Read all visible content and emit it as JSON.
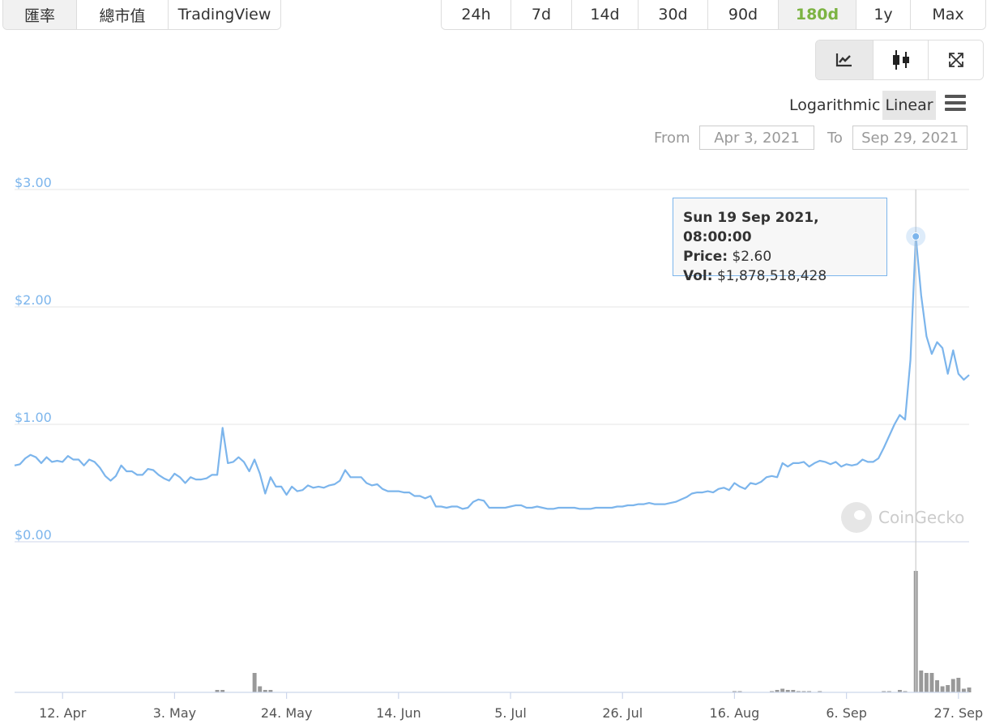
{
  "top_tabs": [
    {
      "label": "匯率",
      "active": true
    },
    {
      "label": "總市值",
      "active": false
    },
    {
      "label": "TradingView",
      "active": false
    }
  ],
  "range_tabs": [
    {
      "label": "24h",
      "active": false
    },
    {
      "label": "7d",
      "active": false
    },
    {
      "label": "14d",
      "active": false
    },
    {
      "label": "30d",
      "active": false
    },
    {
      "label": "90d",
      "active": false
    },
    {
      "label": "180d",
      "active": true
    },
    {
      "label": "1y",
      "active": false
    },
    {
      "label": "Max",
      "active": false
    }
  ],
  "tools": [
    {
      "name": "line-chart-icon",
      "active": true
    },
    {
      "name": "candlestick-icon",
      "active": false
    },
    {
      "name": "fullscreen-icon",
      "active": false
    }
  ],
  "scale": {
    "logarithmic": "Logarithmic",
    "linear": "Linear",
    "selected": "Linear"
  },
  "date_range": {
    "from_label": "From",
    "from_value": "Apr 3, 2021",
    "to_label": "To",
    "to_value": "Sep 29, 2021"
  },
  "tooltip": {
    "date": "Sun 19 Sep 2021, 08:00:00",
    "price_label": "Price:",
    "price_value": "$2.60",
    "vol_label": "Vol:",
    "vol_value": "$1,878,518,428"
  },
  "watermark": "CoinGecko",
  "colors": {
    "line": "#7cb5ec",
    "axis_label": "#7cb5ec",
    "volume": "#999999",
    "active_range": "#7cb342",
    "grid": "#e6e6e6"
  },
  "chart_data": {
    "type": "line",
    "x_start": "2021-04-03",
    "x_end": "2021-09-29",
    "ylim": [
      0,
      3
    ],
    "y_ticks": [
      {
        "value": 0,
        "label": "$0.00"
      },
      {
        "value": 1,
        "label": "$1.00"
      },
      {
        "value": 2,
        "label": "$2.00"
      },
      {
        "value": 3,
        "label": "$3.00"
      }
    ],
    "x_ticks": [
      {
        "date": "2021-04-12",
        "label": "12. Apr"
      },
      {
        "date": "2021-05-03",
        "label": "3. May"
      },
      {
        "date": "2021-05-24",
        "label": "24. May"
      },
      {
        "date": "2021-06-14",
        "label": "14. Jun"
      },
      {
        "date": "2021-07-05",
        "label": "5. Jul"
      },
      {
        "date": "2021-07-26",
        "label": "26. Jul"
      },
      {
        "date": "2021-08-16",
        "label": "16. Aug"
      },
      {
        "date": "2021-09-06",
        "label": "6. Sep"
      },
      {
        "date": "2021-09-27",
        "label": "27. Sep"
      }
    ],
    "grid": true,
    "hover": {
      "date": "2021-09-19",
      "price": 2.6
    },
    "price_series": {
      "name": "Price",
      "points": [
        [
          "2021-04-03",
          0.65
        ],
        [
          "2021-04-04",
          0.66
        ],
        [
          "2021-04-05",
          0.71
        ],
        [
          "2021-04-06",
          0.74
        ],
        [
          "2021-04-07",
          0.72
        ],
        [
          "2021-04-08",
          0.67
        ],
        [
          "2021-04-09",
          0.72
        ],
        [
          "2021-04-10",
          0.68
        ],
        [
          "2021-04-11",
          0.69
        ],
        [
          "2021-04-12",
          0.68
        ],
        [
          "2021-04-13",
          0.73
        ],
        [
          "2021-04-14",
          0.7
        ],
        [
          "2021-04-15",
          0.7
        ],
        [
          "2021-04-16",
          0.65
        ],
        [
          "2021-04-17",
          0.7
        ],
        [
          "2021-04-18",
          0.68
        ],
        [
          "2021-04-19",
          0.63
        ],
        [
          "2021-04-20",
          0.56
        ],
        [
          "2021-04-21",
          0.52
        ],
        [
          "2021-04-22",
          0.56
        ],
        [
          "2021-04-23",
          0.65
        ],
        [
          "2021-04-24",
          0.6
        ],
        [
          "2021-04-25",
          0.6
        ],
        [
          "2021-04-26",
          0.57
        ],
        [
          "2021-04-27",
          0.57
        ],
        [
          "2021-04-28",
          0.62
        ],
        [
          "2021-04-29",
          0.61
        ],
        [
          "2021-04-30",
          0.57
        ],
        [
          "2021-05-01",
          0.54
        ],
        [
          "2021-05-02",
          0.52
        ],
        [
          "2021-05-03",
          0.58
        ],
        [
          "2021-05-04",
          0.55
        ],
        [
          "2021-05-05",
          0.5
        ],
        [
          "2021-05-06",
          0.55
        ],
        [
          "2021-05-07",
          0.53
        ],
        [
          "2021-05-08",
          0.53
        ],
        [
          "2021-05-09",
          0.54
        ],
        [
          "2021-05-10",
          0.57
        ],
        [
          "2021-05-11",
          0.57
        ],
        [
          "2021-05-12",
          0.97
        ],
        [
          "2021-05-13",
          0.67
        ],
        [
          "2021-05-14",
          0.68
        ],
        [
          "2021-05-15",
          0.72
        ],
        [
          "2021-05-16",
          0.68
        ],
        [
          "2021-05-17",
          0.6
        ],
        [
          "2021-05-18",
          0.7
        ],
        [
          "2021-05-19",
          0.58
        ],
        [
          "2021-05-20",
          0.41
        ],
        [
          "2021-05-21",
          0.55
        ],
        [
          "2021-05-22",
          0.47
        ],
        [
          "2021-05-23",
          0.47
        ],
        [
          "2021-05-24",
          0.4
        ],
        [
          "2021-05-25",
          0.47
        ],
        [
          "2021-05-26",
          0.43
        ],
        [
          "2021-05-27",
          0.44
        ],
        [
          "2021-05-28",
          0.48
        ],
        [
          "2021-05-29",
          0.46
        ],
        [
          "2021-05-30",
          0.47
        ],
        [
          "2021-05-31",
          0.46
        ],
        [
          "2021-06-01",
          0.48
        ],
        [
          "2021-06-02",
          0.49
        ],
        [
          "2021-06-03",
          0.52
        ],
        [
          "2021-06-04",
          0.61
        ],
        [
          "2021-06-05",
          0.55
        ],
        [
          "2021-06-06",
          0.55
        ],
        [
          "2021-06-07",
          0.55
        ],
        [
          "2021-06-08",
          0.5
        ],
        [
          "2021-06-09",
          0.48
        ],
        [
          "2021-06-10",
          0.49
        ],
        [
          "2021-06-11",
          0.45
        ],
        [
          "2021-06-12",
          0.43
        ],
        [
          "2021-06-13",
          0.43
        ],
        [
          "2021-06-14",
          0.43
        ],
        [
          "2021-06-15",
          0.42
        ],
        [
          "2021-06-16",
          0.42
        ],
        [
          "2021-06-17",
          0.39
        ],
        [
          "2021-06-18",
          0.39
        ],
        [
          "2021-06-19",
          0.37
        ],
        [
          "2021-06-20",
          0.39
        ],
        [
          "2021-06-21",
          0.3
        ],
        [
          "2021-06-22",
          0.3
        ],
        [
          "2021-06-23",
          0.29
        ],
        [
          "2021-06-24",
          0.3
        ],
        [
          "2021-06-25",
          0.3
        ],
        [
          "2021-06-26",
          0.28
        ],
        [
          "2021-06-27",
          0.29
        ],
        [
          "2021-06-28",
          0.34
        ],
        [
          "2021-06-29",
          0.36
        ],
        [
          "2021-06-30",
          0.35
        ],
        [
          "2021-07-01",
          0.29
        ],
        [
          "2021-07-02",
          0.29
        ],
        [
          "2021-07-03",
          0.29
        ],
        [
          "2021-07-04",
          0.29
        ],
        [
          "2021-07-05",
          0.3
        ],
        [
          "2021-07-06",
          0.31
        ],
        [
          "2021-07-07",
          0.31
        ],
        [
          "2021-07-08",
          0.29
        ],
        [
          "2021-07-09",
          0.29
        ],
        [
          "2021-07-10",
          0.3
        ],
        [
          "2021-07-11",
          0.29
        ],
        [
          "2021-07-12",
          0.28
        ],
        [
          "2021-07-13",
          0.28
        ],
        [
          "2021-07-14",
          0.29
        ],
        [
          "2021-07-15",
          0.29
        ],
        [
          "2021-07-16",
          0.29
        ],
        [
          "2021-07-17",
          0.29
        ],
        [
          "2021-07-18",
          0.28
        ],
        [
          "2021-07-19",
          0.28
        ],
        [
          "2021-07-20",
          0.28
        ],
        [
          "2021-07-21",
          0.29
        ],
        [
          "2021-07-22",
          0.29
        ],
        [
          "2021-07-23",
          0.29
        ],
        [
          "2021-07-24",
          0.29
        ],
        [
          "2021-07-25",
          0.3
        ],
        [
          "2021-07-26",
          0.3
        ],
        [
          "2021-07-27",
          0.31
        ],
        [
          "2021-07-28",
          0.31
        ],
        [
          "2021-07-29",
          0.32
        ],
        [
          "2021-07-30",
          0.32
        ],
        [
          "2021-07-31",
          0.33
        ],
        [
          "2021-08-01",
          0.32
        ],
        [
          "2021-08-02",
          0.32
        ],
        [
          "2021-08-03",
          0.32
        ],
        [
          "2021-08-04",
          0.33
        ],
        [
          "2021-08-05",
          0.34
        ],
        [
          "2021-08-06",
          0.36
        ],
        [
          "2021-08-07",
          0.38
        ],
        [
          "2021-08-08",
          0.41
        ],
        [
          "2021-08-09",
          0.42
        ],
        [
          "2021-08-10",
          0.42
        ],
        [
          "2021-08-11",
          0.43
        ],
        [
          "2021-08-12",
          0.42
        ],
        [
          "2021-08-13",
          0.45
        ],
        [
          "2021-08-14",
          0.46
        ],
        [
          "2021-08-15",
          0.44
        ],
        [
          "2021-08-16",
          0.5
        ],
        [
          "2021-08-17",
          0.47
        ],
        [
          "2021-08-18",
          0.45
        ],
        [
          "2021-08-19",
          0.5
        ],
        [
          "2021-08-20",
          0.49
        ],
        [
          "2021-08-21",
          0.51
        ],
        [
          "2021-08-22",
          0.55
        ],
        [
          "2021-08-23",
          0.56
        ],
        [
          "2021-08-24",
          0.55
        ],
        [
          "2021-08-25",
          0.67
        ],
        [
          "2021-08-26",
          0.64
        ],
        [
          "2021-08-27",
          0.67
        ],
        [
          "2021-08-28",
          0.67
        ],
        [
          "2021-08-29",
          0.68
        ],
        [
          "2021-08-30",
          0.64
        ],
        [
          "2021-08-31",
          0.67
        ],
        [
          "2021-09-01",
          0.69
        ],
        [
          "2021-09-02",
          0.68
        ],
        [
          "2021-09-03",
          0.66
        ],
        [
          "2021-09-04",
          0.68
        ],
        [
          "2021-09-05",
          0.64
        ],
        [
          "2021-09-06",
          0.66
        ],
        [
          "2021-09-07",
          0.65
        ],
        [
          "2021-09-08",
          0.66
        ],
        [
          "2021-09-09",
          0.7
        ],
        [
          "2021-09-10",
          0.68
        ],
        [
          "2021-09-11",
          0.68
        ],
        [
          "2021-09-12",
          0.71
        ],
        [
          "2021-09-13",
          0.8
        ],
        [
          "2021-09-14",
          0.9
        ],
        [
          "2021-09-15",
          1.0
        ],
        [
          "2021-09-16",
          1.08
        ],
        [
          "2021-09-17",
          1.04
        ],
        [
          "2021-09-18",
          1.55
        ],
        [
          "2021-09-19",
          2.6
        ],
        [
          "2021-09-20",
          2.1
        ],
        [
          "2021-09-21",
          1.75
        ],
        [
          "2021-09-22",
          1.6
        ],
        [
          "2021-09-23",
          1.7
        ],
        [
          "2021-09-24",
          1.65
        ],
        [
          "2021-09-25",
          1.43
        ],
        [
          "2021-09-26",
          1.63
        ],
        [
          "2021-09-27",
          1.43
        ],
        [
          "2021-09-28",
          1.38
        ],
        [
          "2021-09-29",
          1.42
        ]
      ]
    },
    "volume_series": {
      "name": "Vol",
      "points": [
        [
          "2021-05-11",
          0.02
        ],
        [
          "2021-05-12",
          0.02
        ],
        [
          "2021-05-18",
          0.16
        ],
        [
          "2021-05-19",
          0.05
        ],
        [
          "2021-05-20",
          0.02
        ],
        [
          "2021-05-21",
          0.02
        ],
        [
          "2021-08-16",
          0.01
        ],
        [
          "2021-08-17",
          0.01
        ],
        [
          "2021-08-23",
          0.01
        ],
        [
          "2021-08-24",
          0.02
        ],
        [
          "2021-08-25",
          0.03
        ],
        [
          "2021-08-26",
          0.02
        ],
        [
          "2021-08-27",
          0.02
        ],
        [
          "2021-08-28",
          0.01
        ],
        [
          "2021-08-29",
          0.01
        ],
        [
          "2021-08-30",
          0.01
        ],
        [
          "2021-09-01",
          0.01
        ],
        [
          "2021-09-13",
          0.01
        ],
        [
          "2021-09-14",
          0.01
        ],
        [
          "2021-09-16",
          0.02
        ],
        [
          "2021-09-17",
          0.01
        ],
        [
          "2021-09-19",
          1.0
        ],
        [
          "2021-09-20",
          0.18
        ],
        [
          "2021-09-21",
          0.16
        ],
        [
          "2021-09-22",
          0.16
        ],
        [
          "2021-09-23",
          0.1
        ],
        [
          "2021-09-24",
          0.05
        ],
        [
          "2021-09-25",
          0.06
        ],
        [
          "2021-09-26",
          0.11
        ],
        [
          "2021-09-27",
          0.12
        ],
        [
          "2021-09-28",
          0.03
        ],
        [
          "2021-09-29",
          0.04
        ]
      ]
    }
  }
}
